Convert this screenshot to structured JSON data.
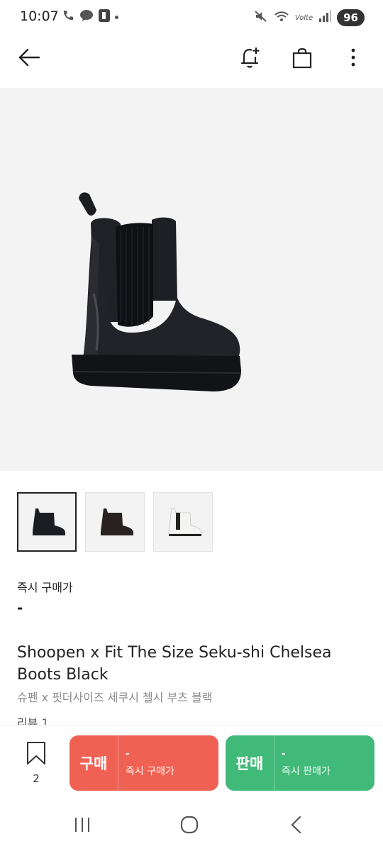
{
  "status_bar": {
    "time": "10:07",
    "network_label": "Volte",
    "battery": "96"
  },
  "header": {
    "back_icon": "arrow-left-icon",
    "alert_icon": "bell-plus-icon",
    "bag_icon": "shopping-bag-icon",
    "more_icon": "more-vertical-icon"
  },
  "gallery": {
    "thumbnails": [
      {
        "color": "#1c1d22",
        "selected": true
      },
      {
        "color": "#2a2122",
        "selected": false
      },
      {
        "color": "#f4f4f2",
        "selected": false
      }
    ]
  },
  "price": {
    "label": "즉시 구매가",
    "value": "-"
  },
  "product": {
    "title": "Shoopen x Fit The Size Seku-shi Chelsea Boots Black",
    "subtitle": "슈펜 x 핏더사이즈 세쿠시 첼시 부츠 블랙",
    "reviews": "리뷰 1"
  },
  "action_bar": {
    "wish_count": "2",
    "buy": {
      "label": "구매",
      "price": "-",
      "sub": "즉시 구매가",
      "color": "#ef6253"
    },
    "sell": {
      "label": "판매",
      "price": "-",
      "sub": "즉시 판매가",
      "color": "#41b979"
    }
  }
}
